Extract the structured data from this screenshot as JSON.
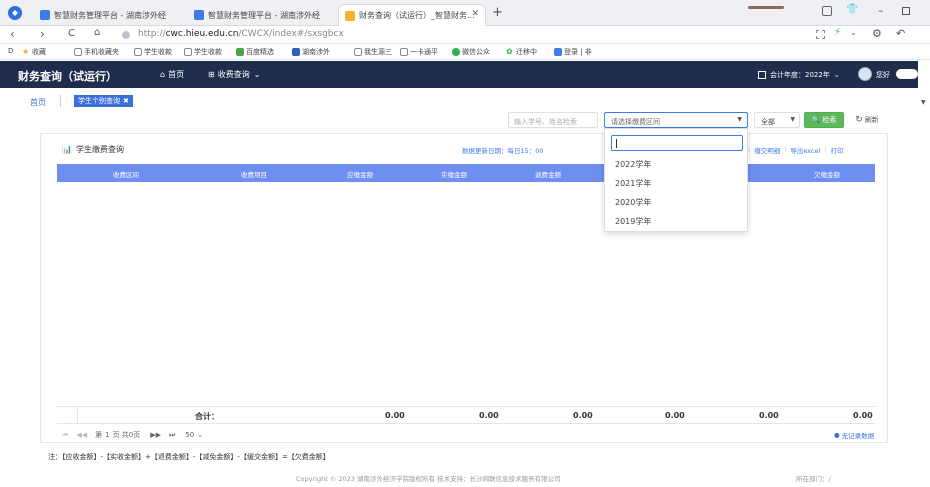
{
  "browser": {
    "tabs": [
      {
        "title": "智慧财务管理平台 - 湖南涉外经",
        "active": false
      },
      {
        "title": "智慧财务管理平台 - 湖南涉外经",
        "active": false
      },
      {
        "title": "财务查询（试运行）_智慧财务...",
        "active": true
      }
    ],
    "new_tab": "+",
    "url_prefix": "http://",
    "url_host": "cwc.hieu.edu.cn",
    "url_path": "/CWCX/index#/sxsgbcx",
    "bookmarks": [
      "收藏",
      "手机收藏夹",
      "学生收款",
      "学生收款",
      "百度精选",
      "湖南涉外",
      "我生源三",
      "一卡通平",
      "微信公众",
      "迁移中",
      "登录 | 非"
    ],
    "colors": {
      "tab_bar": "#eef0f3",
      "accent": "#4a7ff0"
    }
  },
  "app": {
    "brand": "财务查询（试运行）",
    "nav": [
      {
        "icon": "home-icon",
        "label": "首页"
      },
      {
        "icon": "grid-icon",
        "label": "收费查询"
      }
    ],
    "fiscal_year": "会计年度：2022年",
    "user": "您好",
    "nav_color": "#1f2d4d"
  },
  "breadcrumb": {
    "home": "首页",
    "current_tab": "学生个别查询"
  },
  "search": {
    "student_placeholder": "输入学号、姓名检索",
    "period_placeholder": "请选择缴费区间",
    "scope_value": "全部",
    "search_button": "检索",
    "refresh_button": "刷新"
  },
  "card": {
    "title": "学生缴费查询",
    "update_text": "数据更新日期：每日15：00",
    "actions": [
      "缴交明细",
      "导出excel",
      "打印"
    ]
  },
  "table": {
    "columns": [
      "收费区间",
      "收费项目",
      "应缴金额",
      "实缴金额",
      "退费金额",
      "",
      "",
      "欠缴金额"
    ],
    "footer_label": "合计：",
    "footer_values": [
      "0.00",
      "0.00",
      "0.00",
      "0.00",
      "0.00",
      "0.00"
    ]
  },
  "pagination": {
    "page_prefix": "第",
    "page_number": "1",
    "page_suffix": "页 共0页",
    "page_size": "50",
    "no_records": "无记录数据"
  },
  "dropdown": {
    "options": [
      "2022学年",
      "2021学年",
      "2020学年",
      "2019学年"
    ]
  },
  "note": "注：【应收金额】-【实收金额】+【退费金额】-【减免金额】-【缓交金额】=【欠费金额】",
  "footer": {
    "copyright": "Copyright © 2023 湖南涉外经济学院版权所有    技术支持：长沙网联信息技术服务有限公司",
    "dept": "所在部门：/"
  }
}
